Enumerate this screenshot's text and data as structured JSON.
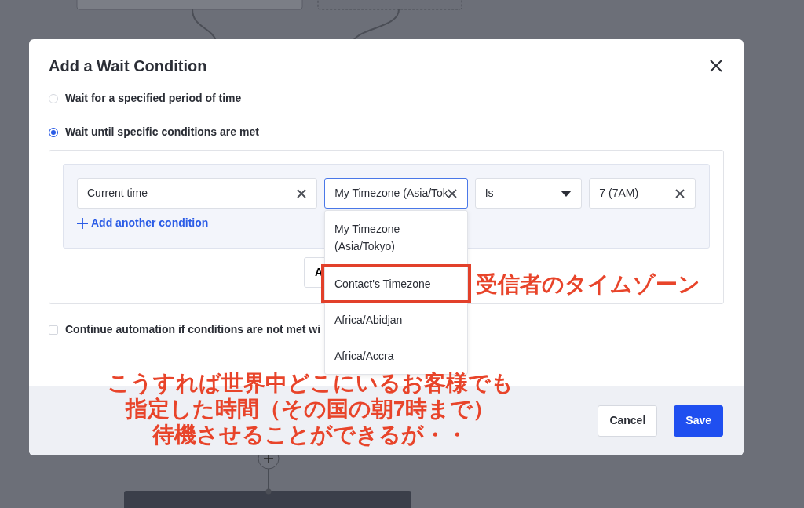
{
  "dialog": {
    "title": "Add a Wait Condition",
    "options": [
      {
        "label": "Wait for a specified period of time",
        "selected": false
      },
      {
        "label": "Wait until specific conditions are met",
        "selected": true
      }
    ],
    "condition": {
      "fields": [
        {
          "kind": "clearable",
          "value": "Current time",
          "focused": false
        },
        {
          "kind": "clearable",
          "value": "My Timezone (Asia/Tok",
          "focused": true
        },
        {
          "kind": "select",
          "value": "Is",
          "focused": false
        },
        {
          "kind": "clearable",
          "value": "7 (7AM)",
          "focused": false
        }
      ],
      "add_link": "Add another condition",
      "partial_button": "A"
    },
    "dropdown": [
      {
        "label": "My Timezone (Asia/Tokyo)",
        "marked": false
      },
      {
        "label": "Contact's Timezone",
        "marked": true
      },
      {
        "label": "Africa/Abidjan",
        "marked": false
      },
      {
        "label": "Africa/Accra",
        "marked": false
      }
    ],
    "continue": {
      "label": "Continue automation if conditions are not met wi",
      "checked": false
    },
    "buttons": [
      {
        "label": "Cancel",
        "kind": "secondary"
      },
      {
        "label": "Save",
        "kind": "primary"
      }
    ]
  },
  "annotations": {
    "dropdown_note": "受信者のタイムゾーン",
    "note_lines": [
      "こうすれば世界中どこにいるお客様でも",
      "指定した時間（その国の朝7時まで）",
      "待機させることができるが・・"
    ]
  }
}
